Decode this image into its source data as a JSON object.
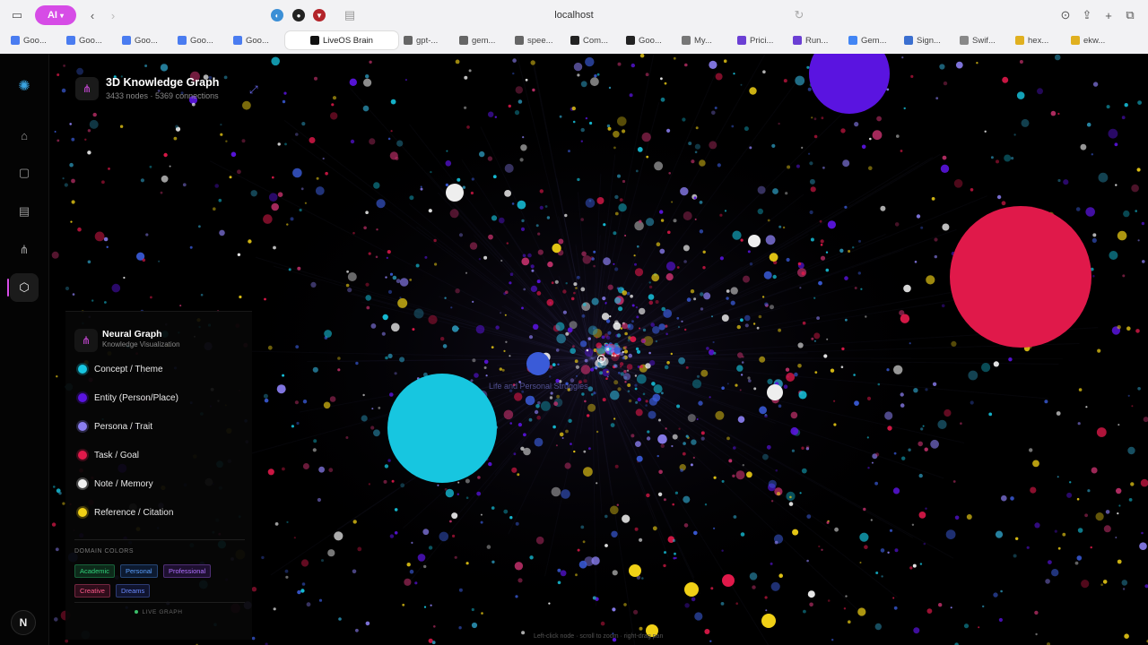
{
  "browser": {
    "ai_button": "AI",
    "url": "localhost",
    "tabs": [
      {
        "label": "Goo...",
        "icon": "gemini-icon",
        "color": "#4a7cf0"
      },
      {
        "label": "Goo...",
        "icon": "gemini-icon",
        "color": "#4a7cf0"
      },
      {
        "label": "Goo...",
        "icon": "gemini-icon",
        "color": "#4a7cf0"
      },
      {
        "label": "Goo...",
        "icon": "gemini-icon",
        "color": "#4a7cf0"
      },
      {
        "label": "Goo...",
        "icon": "gemini-icon",
        "color": "#4a7cf0"
      },
      {
        "label": "LiveOS Brain",
        "icon": "liveos-icon",
        "color": "#111111",
        "active": true
      },
      {
        "label": "gpt-...",
        "icon": "doc-icon",
        "color": "#666666"
      },
      {
        "label": "gem...",
        "icon": "doc-icon",
        "color": "#666666"
      },
      {
        "label": "spee...",
        "icon": "doc-icon",
        "color": "#666666"
      },
      {
        "label": "Com...",
        "icon": "github-icon",
        "color": "#222222"
      },
      {
        "label": "Goo...",
        "icon": "dark-square-icon",
        "color": "#222222"
      },
      {
        "label": "My...",
        "icon": "gear-icon",
        "color": "#777777"
      },
      {
        "label": "Prici...",
        "icon": "purple-square-icon",
        "color": "#6b3fd4"
      },
      {
        "label": "Run...",
        "icon": "purple-square-icon",
        "color": "#6b3fd4"
      },
      {
        "label": "Gem...",
        "icon": "google-g-icon",
        "color": "#4285f4"
      },
      {
        "label": "Sign...",
        "icon": "bracket-icon",
        "color": "#3b6fd0"
      },
      {
        "label": "Swif...",
        "icon": "bird-icon",
        "color": "#888888"
      },
      {
        "label": "hex...",
        "icon": "smile-icon",
        "color": "#e0b020"
      },
      {
        "label": "ekw...",
        "icon": "smile-icon",
        "color": "#e0b020"
      }
    ]
  },
  "header": {
    "title": "3D Knowledge Graph",
    "stats": "3433 nodes · 5369 connections"
  },
  "panel": {
    "title": "Neural Graph",
    "subtitle": "Knowledge Visualization",
    "legend": [
      {
        "label": "Concept / Theme",
        "color": "#17c6e0"
      },
      {
        "label": "Entity (Person/Place)",
        "color": "#5a14e0"
      },
      {
        "label": "Persona / Trait",
        "color": "#8a7ef0"
      },
      {
        "label": "Task / Goal",
        "color": "#e0194a"
      },
      {
        "label": "Note / Memory",
        "color": "#f2f2f2"
      },
      {
        "label": "Reference / Citation",
        "color": "#f0d016"
      }
    ],
    "domain_label": "DOMAIN COLORS",
    "domains": [
      {
        "label": "Academic",
        "color": "#2fd27a",
        "bg": "#0d2a1a"
      },
      {
        "label": "Personal",
        "color": "#5aa0ff",
        "bg": "#0d1a30"
      },
      {
        "label": "Professional",
        "color": "#b070ff",
        "bg": "#1e1030"
      },
      {
        "label": "Creative",
        "color": "#ff5a8a",
        "bg": "#2e0d1a"
      },
      {
        "label": "Dreams",
        "color": "#6a8aff",
        "bg": "#10142e"
      }
    ],
    "status": "LIVE GRAPH"
  },
  "graph_label": "Life and Personal Struggles",
  "bottom_hint": "Left-click node · scroll to zoom · right-drag pan"
}
